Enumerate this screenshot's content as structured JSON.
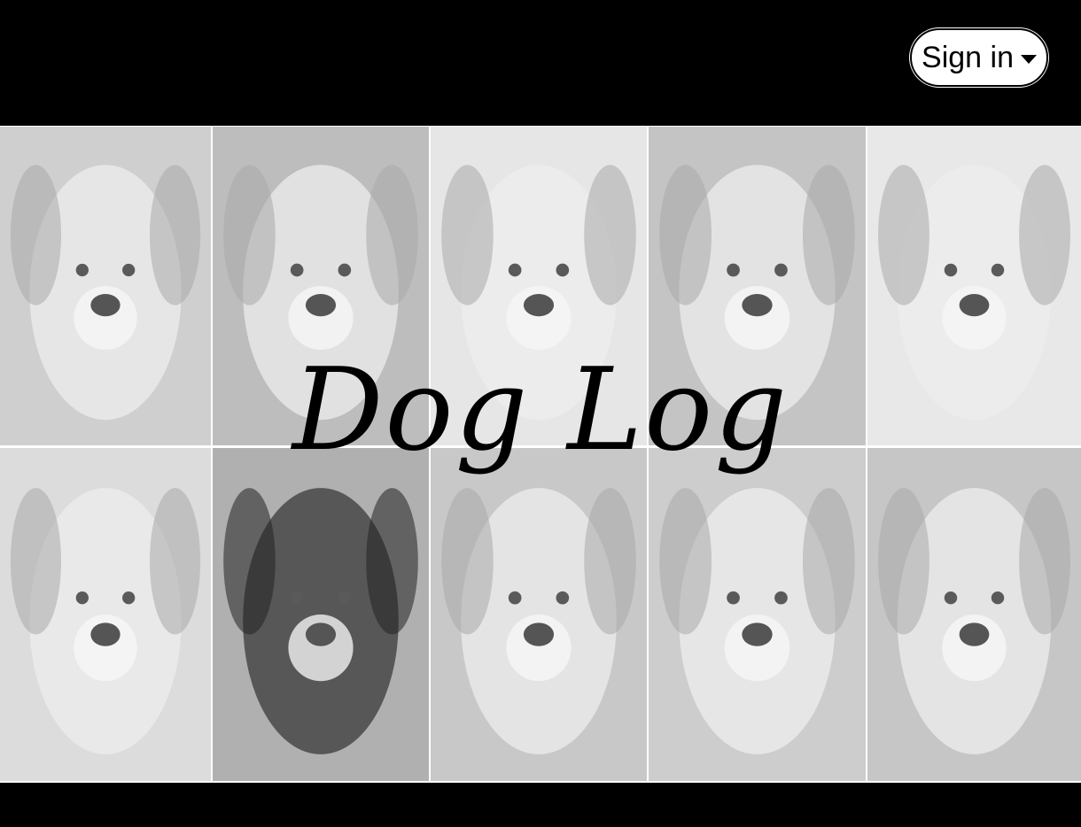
{
  "header": {
    "signin_label": "Sign in",
    "signin_icon": "chevron-down-icon"
  },
  "hero": {
    "title": "Dog Log",
    "tiles": [
      {
        "breed_look": "papillon",
        "tone": "#cfcfcf"
      },
      {
        "breed_look": "mixed-terrier",
        "tone": "#bdbdbd"
      },
      {
        "breed_look": "golden-puppy",
        "tone": "#e6e6e6"
      },
      {
        "breed_look": "long-haired-terrier",
        "tone": "#c4c4c4"
      },
      {
        "breed_look": "maltese",
        "tone": "#e8e8e8"
      },
      {
        "breed_look": "labrador",
        "tone": "#dcdcdc"
      },
      {
        "breed_look": "bernese-mountain-dog",
        "tone": "#b0b0b0"
      },
      {
        "breed_look": "finnish-lapphund",
        "tone": "#c8c8c8"
      },
      {
        "breed_look": "shepherd-mix",
        "tone": "#cdcdcd"
      },
      {
        "breed_look": "golden-retriever",
        "tone": "#c6c6c6"
      }
    ]
  },
  "colors": {
    "background": "#000000",
    "button_bg": "#ffffff",
    "text": "#000000"
  }
}
